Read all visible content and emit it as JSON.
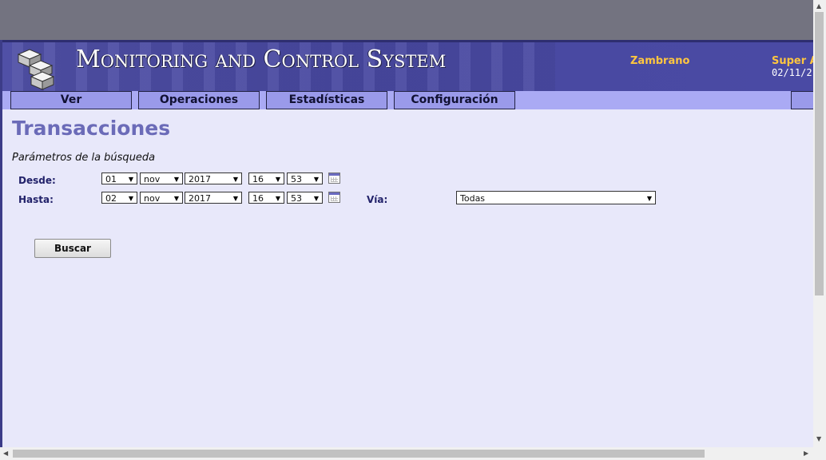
{
  "header": {
    "title": "Monitoring and Control System",
    "user": "Zambrano",
    "role": "Super A",
    "date": "02/11/2"
  },
  "menu": [
    "Ver",
    "Operaciones",
    "Estadísticas",
    "Configuración"
  ],
  "page": {
    "title": "Transacciones",
    "section": "Parámetros de la búsqueda"
  },
  "form": {
    "desde": {
      "label": "Desde:",
      "day": "01",
      "month": "nov",
      "year": "2017",
      "hour": "16",
      "minute": "53"
    },
    "hasta": {
      "label": "Hasta:",
      "day": "02",
      "month": "nov",
      "year": "2017",
      "hour": "16",
      "minute": "53"
    },
    "via": {
      "label": "Vía:",
      "value": "Todas"
    },
    "search_button": "Buscar"
  },
  "colors": {
    "banner": "#4848a0",
    "menubar": "#aaaaf4",
    "background": "#e8e8fa",
    "title_accent": "#6b6bb8",
    "user_text": "#ffc640"
  },
  "icons": [
    "logo-cubes-icon",
    "calendar-icon",
    "dropdown-arrow-icon",
    "scroll-arrow-icon"
  ]
}
